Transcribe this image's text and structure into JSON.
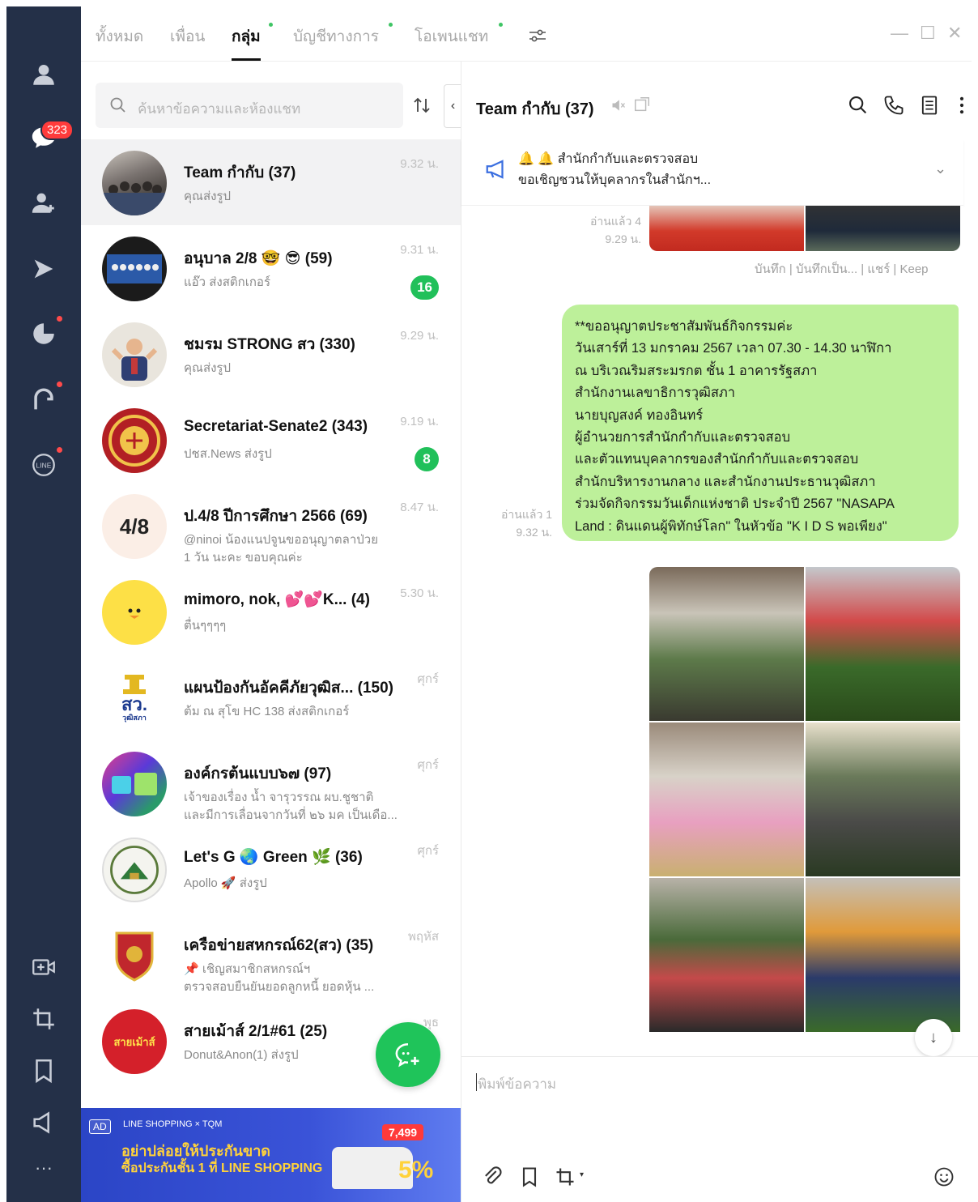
{
  "rail": {
    "chat_badge": "323"
  },
  "tabs": [
    {
      "label": "ทั้งหมด"
    },
    {
      "label": "เพื่อน"
    },
    {
      "label": "กลุ่ม"
    },
    {
      "label": "บัญชีทางการ"
    },
    {
      "label": "โอเพนแชท"
    }
  ],
  "search": {
    "placeholder": "ค้นหาข้อความและห้องแชท"
  },
  "chats": [
    {
      "name": "Team กำกับ (37)",
      "sub": "คุณส่งรูป",
      "sub2": "",
      "time": "9.32 น.",
      "badge": ""
    },
    {
      "name": "อนุบาล 2/8 🤓 😎 (59)",
      "sub": "แอ๊ว ส่งสติกเกอร์",
      "sub2": "",
      "time": "9.31 น.",
      "badge": "16"
    },
    {
      "name": "ชมรม STRONG สว (330)",
      "sub": "คุณส่งรูป",
      "sub2": "",
      "time": "9.29 น.",
      "badge": ""
    },
    {
      "name": "Secretariat-Senate2 (343)",
      "sub": "ปชส.News ส่งรูป",
      "sub2": "",
      "time": "9.19 น.",
      "badge": "8"
    },
    {
      "name": "ป.4/8 ปีการศึกษา 2566 (69)",
      "sub": "@ninoi น้องแนปจูนขออนุญาตลาป่วย",
      "sub2": "1 วัน นะคะ ขอบคุณค่ะ",
      "time": "8.47 น.",
      "badge": ""
    },
    {
      "name": "mimoro, nok, 💕💕K... (4)",
      "sub": "ตื่นๆๆๆๆ",
      "sub2": "",
      "time": "5.30 น.",
      "badge": ""
    },
    {
      "name": "แผนป้องกันอัคคีภัยวุฒิส... (150)",
      "sub": "ต้ม ณ สุโข HC 138 ส่งสติกเกอร์",
      "sub2": "",
      "time": "ศุกร์",
      "badge": ""
    },
    {
      "name": "องค์กรต้นแบบ๖๗ (97)",
      "sub": "เจ้าของเรื่อง น้ำ จารุวรรณ ผบ.ชูชาติ",
      "sub2": "และมีการเลื่อนจากวันที่ ๒๖ มค เป็นเดือ...",
      "time": "ศุกร์",
      "badge": ""
    },
    {
      "name": "Let's G 🌏 Green 🌿 (36)",
      "sub": "Apollo 🚀 ส่งรูป",
      "sub2": "",
      "time": "ศุกร์",
      "badge": ""
    },
    {
      "name": "เครือข่ายสหกรณ์62(สว) (35)",
      "sub": "📌 เชิญสมาชิกสหกรณ์ฯ",
      "sub2": "ตรวจสอบยืนยันยอดลูกหนี้ ยอดหุ้น ...",
      "time": "พฤหัส",
      "badge": ""
    },
    {
      "name": "สายเม้าส์ 2/1#61 (25)",
      "sub": "Donut&Anon(1) ส่งรูป",
      "sub2": "",
      "time": "พุธ",
      "badge": ""
    }
  ],
  "avatar_labels": {
    "p48": "4/8",
    "sorwor": "สว.",
    "sorwor_sub": "วุฒิสภา",
    "saimao": "สายเม้าส์"
  },
  "ad": {
    "tag": "AD",
    "brand": "LINE SHOPPING × TQM",
    "line1": "อย่าปล่อยให้ประกันขาด",
    "line2": "ซื้อประกันชั้น 1 ที่ LINE SHOPPING",
    "price": "7,499",
    "discount": "5%"
  },
  "chat": {
    "title": "Team กำกับ (37)",
    "announce_line1": "🔔 🔔 สำนักกำกับและตรวจสอบ",
    "announce_line2": "ขอเชิญชวนให้บุคลากรในสำนักฯ...",
    "first_read": "อ่านแล้ว 4",
    "first_time": "9.29 น.",
    "actions": "บันทึก | บันทึกเป็น... | แชร์ | Keep",
    "bubble_lines": [
      "**ขออนุญาตประชาสัมพันธ์กิจกรรมค่ะ",
      "วันเสาร์ที่ 13 มกราคม 2567 เวลา 07.30 - 14.30 นาฬิกา",
      "ณ บริเวณริมสระมรกต ชั้น 1 อาคารรัฐสภา",
      "สำนักงานเลขาธิการวุฒิสภา",
      "นายบุญสงค์ ทองอินทร์",
      "ผู้อำนวยการสำนักกำกับและตรวจสอบ",
      "และตัวแทนบุคลากรของสำนักกำกับและตรวจสอบ",
      "สำนักบริหารงานกลาง และสำนักงานประธานวุฒิสภา",
      "ร่วมจัดกิจกรรมวันเด็กแห่งชาติ ประจำปี 2567 \"NASAPA",
      "Land : ดินแดนผู้พิทักษ์โลก\" ในหัวข้อ \"K I D S พอเพียง\""
    ],
    "bubble_read": "อ่านแล้ว 1",
    "bubble_time": "9.32 น.",
    "composer_placeholder": "พิมพ์ข้อความ"
  },
  "colors": {
    "rail": "#243048",
    "accent_green": "#21c05a",
    "bubble": "#bdf09a",
    "badge_red": "#ff3b3b"
  }
}
